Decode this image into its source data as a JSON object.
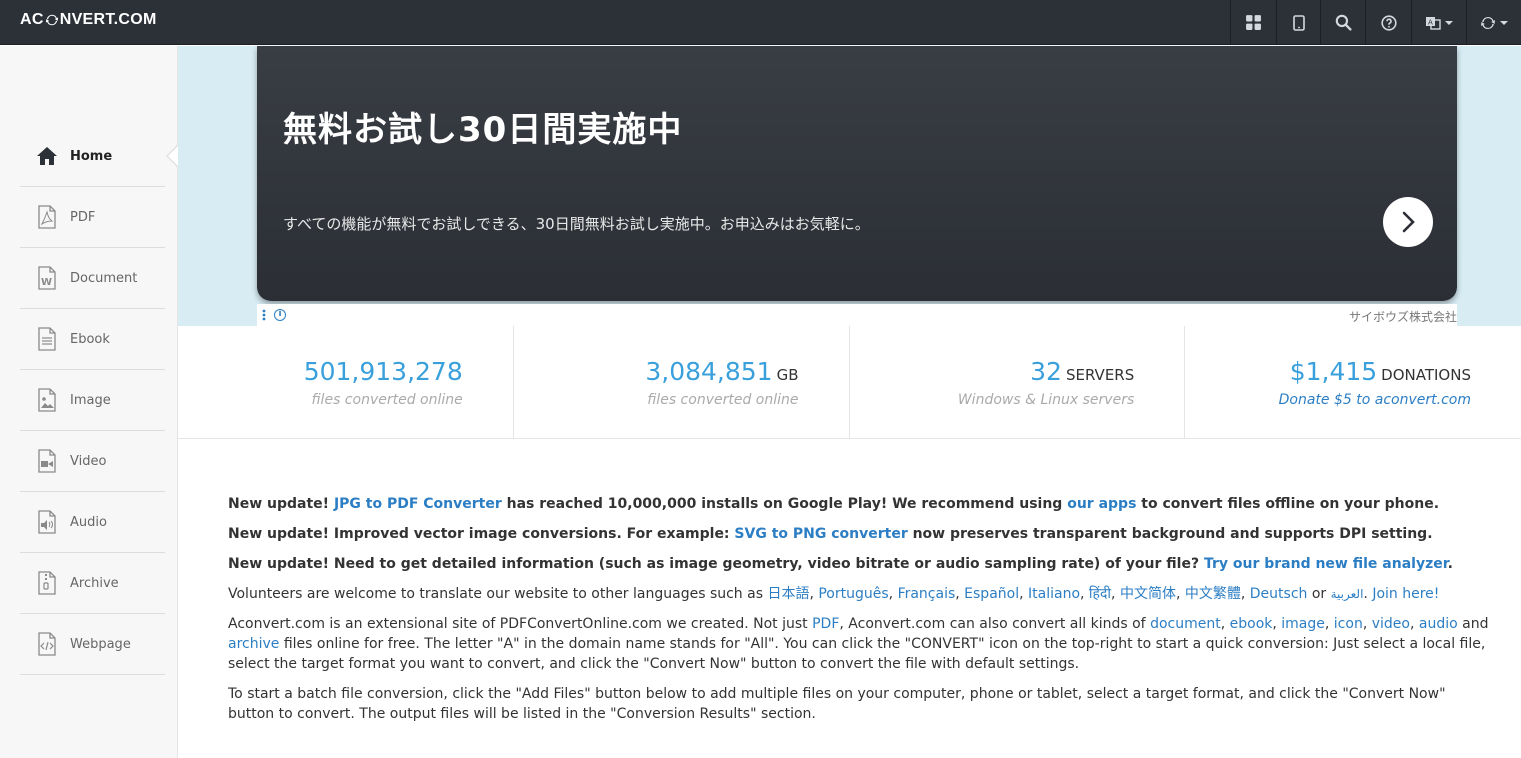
{
  "header": {
    "logo_left": "AC",
    "logo_right": "NVERT.COM",
    "nav_icons": [
      "grid-icon",
      "tablet-icon",
      "search-icon",
      "help-icon",
      "language-icon",
      "convert-icon"
    ]
  },
  "sidebar": {
    "items": [
      {
        "label": "Home",
        "icon": "home-icon"
      },
      {
        "label": "PDF",
        "icon": "pdf-icon"
      },
      {
        "label": "Document",
        "icon": "document-icon"
      },
      {
        "label": "Ebook",
        "icon": "ebook-icon"
      },
      {
        "label": "Image",
        "icon": "image-icon"
      },
      {
        "label": "Video",
        "icon": "video-icon"
      },
      {
        "label": "Audio",
        "icon": "audio-icon"
      },
      {
        "label": "Archive",
        "icon": "archive-icon"
      },
      {
        "label": "Webpage",
        "icon": "webpage-icon"
      }
    ]
  },
  "ad": {
    "title": "無料お試し30日間実施中",
    "subtitle": "すべての機能が無料でお試しできる、30日間無料お試し実施中。お申込みはお気軽に。",
    "sponsor": "サイボウズ株式会社"
  },
  "stats": [
    {
      "value": "501,913,278",
      "unit": "",
      "caption": "files converted online"
    },
    {
      "value": "3,084,851",
      "unit": "GB",
      "caption": "files converted online"
    },
    {
      "value": "32",
      "unit": "SERVERS",
      "caption": "Windows & Linux servers"
    },
    {
      "value": "$1,415",
      "unit": "DONATIONS",
      "caption": "Donate $5 to aconvert.com"
    }
  ],
  "content": {
    "p1": {
      "a": "New update! ",
      "l1": "JPG to PDF Converter",
      "b": " has reached 10,000,000 installs on Google Play! We recommend using ",
      "l2": "our apps",
      "c": " to convert files offline on your phone."
    },
    "p2": {
      "a": "New update! Improved vector image conversions. For example: ",
      "l1": "SVG to PNG converter",
      "b": " now preserves transparent background and supports DPI setting."
    },
    "p3": {
      "a": "New update! Need to get detailed information (such as image geometry, video bitrate or audio sampling rate) of your file? ",
      "l1": "Try our brand new file analyzer",
      "b": "."
    },
    "p4": {
      "a": "Volunteers are welcome to translate our website to other languages such as ",
      "langs": [
        "日本語",
        "Português",
        "Français",
        "Español",
        "Italiano",
        "हिंदी",
        "中文简体",
        "中文繁體",
        "Deutsch"
      ],
      "or": " or ",
      "arabic": "العربية",
      "join": "Join here!"
    },
    "p5": {
      "a": "Aconvert.com is an extensional site of PDFConvertOnline.com we created. Not just ",
      "pdf": "PDF",
      "b": ", Aconvert.com can also convert all kinds of ",
      "document": "document",
      "ebook": "ebook",
      "image": "image",
      "icon": "icon",
      "video": "video",
      "audio": "audio",
      "and": " and ",
      "archive": "archive",
      "c": " files online for free. The letter \"A\" in the domain name stands for \"All\". You can click the \"CONVERT\" icon on the top-right to start a quick conversion: Just select a local file, select the target format you want to convert, and click the \"Convert Now\" button to convert the file with default settings."
    },
    "p6": "To start a batch file conversion, click the \"Add Files\" button below to add multiple files on your computer, phone or tablet, select a target format, and click the \"Convert Now\" button to convert. The output files will be listed in the \"Conversion Results\" section."
  }
}
